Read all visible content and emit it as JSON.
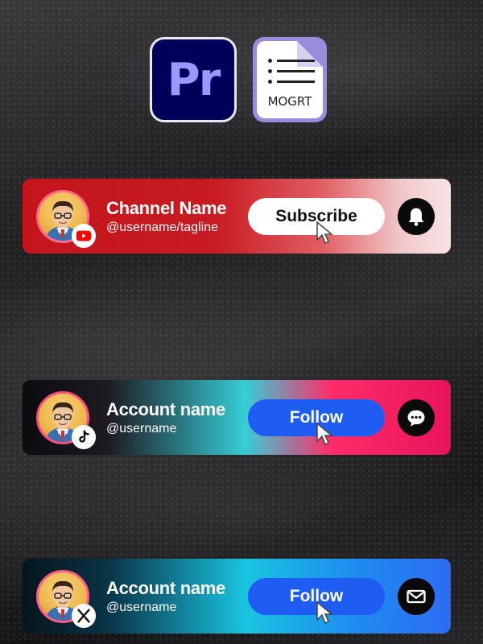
{
  "apps": {
    "premiere_label": "Pr",
    "mogrt_label": "MOGRT"
  },
  "banners": [
    {
      "platform_icon": "youtube-icon",
      "name": "Channel Name",
      "handle": "@username/tagline",
      "button_label": "Subscribe",
      "action_icon": "bell-icon"
    },
    {
      "platform_icon": "tiktok-icon",
      "name": "Account name",
      "handle": "@username",
      "button_label": "Follow",
      "action_icon": "chat-bubble-icon"
    },
    {
      "platform_icon": "x-icon",
      "name": "Account name",
      "handle": "@username",
      "button_label": "Follow",
      "action_icon": "mail-icon"
    }
  ],
  "colors": {
    "premiere_bg": "#00005b",
    "premiere_text": "#9999ff",
    "youtube_red": "#c3151b",
    "follow_blue": "#1f5df2"
  }
}
